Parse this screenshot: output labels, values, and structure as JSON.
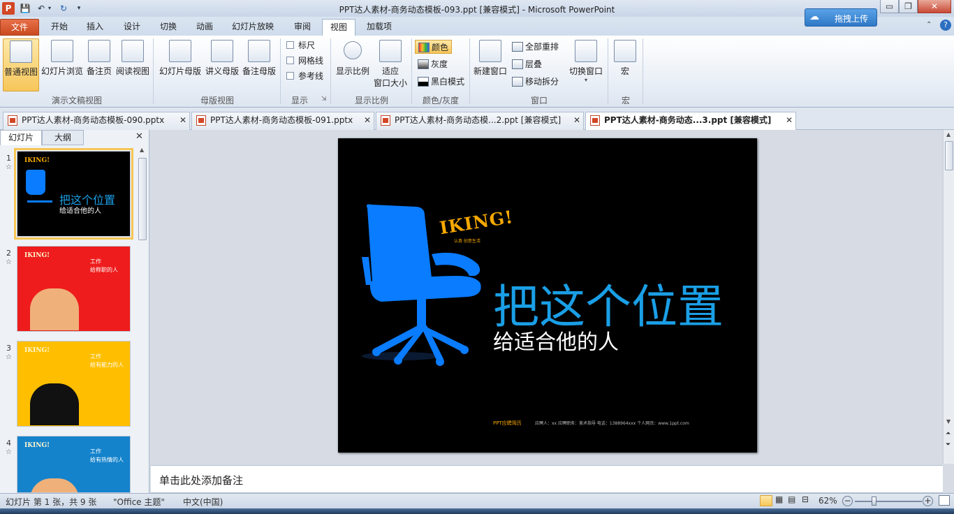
{
  "window": {
    "title": "PPT达人素材-商务动态模板-093.ppt [兼容模式] - Microsoft PowerPoint"
  },
  "title_controls": {
    "minimize": "▭",
    "restore": "❐",
    "close": "✕"
  },
  "cloud_upload": {
    "label": "拖拽上传"
  },
  "menu_tabs": [
    "文件",
    "开始",
    "插入",
    "设计",
    "切换",
    "动画",
    "幻灯片放映",
    "审阅",
    "视图",
    "加载项"
  ],
  "ribbon": {
    "presentation_views": {
      "label": "演示文稿视图",
      "buttons": [
        "普通视图",
        "幻灯片浏览",
        "备注页",
        "阅读视图"
      ]
    },
    "master_views": {
      "label": "母版视图",
      "buttons": [
        "幻灯片母版",
        "讲义母版",
        "备注母版"
      ]
    },
    "show": {
      "label": "显示",
      "checks": [
        "标尺",
        "网格线",
        "参考线"
      ]
    },
    "zoom": {
      "label": "显示比例",
      "buttons": [
        "显示比例"
      ],
      "fit_line1": "适应",
      "fit_line2": "窗口大小"
    },
    "color": {
      "label": "颜色/灰度",
      "items": [
        "颜色",
        "灰度",
        "黑白模式"
      ]
    },
    "window": {
      "label": "窗口",
      "new_window": "新建窗口",
      "items": [
        "全部重排",
        "层叠",
        "移动拆分"
      ],
      "switch": "切换窗口"
    },
    "macro": {
      "label": "宏",
      "button": "宏"
    }
  },
  "doc_tabs": [
    "PPT达人素材-商务动态模板-090.pptx",
    "PPT达人素材-商务动态模板-091.pptx",
    "PPT达人素材-商务动态模...2.ppt [兼容模式]",
    "PPT达人素材-商务动态...3.ppt [兼容模式]"
  ],
  "pane_tabs": {
    "slides": "幻灯片",
    "outline": "大纲"
  },
  "slides": [
    {
      "num": "1",
      "bg": "#000000",
      "title": "把这个位置",
      "subtitle": "给适合他的人"
    },
    {
      "num": "2",
      "bg": "#ee1c1c",
      "title": "工作",
      "subtitle": "给称职的人"
    },
    {
      "num": "3",
      "bg": "#ffbf00",
      "title": "工作",
      "subtitle": "给有能力的人"
    },
    {
      "num": "4",
      "bg": "#1583cc",
      "title": "工作",
      "subtitle": "给有热情的人"
    }
  ],
  "main_slide": {
    "logo": "IKING!",
    "logo_tag": "认真 创意生活",
    "title": "把这个位置",
    "subtitle": "给适合他的人",
    "footer_brand": "PPT应聘简历",
    "footer_info": "应聘人：xx    应聘职务：美术指导    电话：1388964xxx    个人网页：www.1ppt.com",
    "colors": {
      "chair": "#0a7cff",
      "title": "#1a9fe6",
      "logo": "#f7a800"
    }
  },
  "notes_placeholder": "单击此处添加备注",
  "status": {
    "slide_info": "幻灯片 第 1 张，共 9 张",
    "theme": "\"Office 主题\"",
    "language": "中文(中国)",
    "zoom": "62%"
  }
}
